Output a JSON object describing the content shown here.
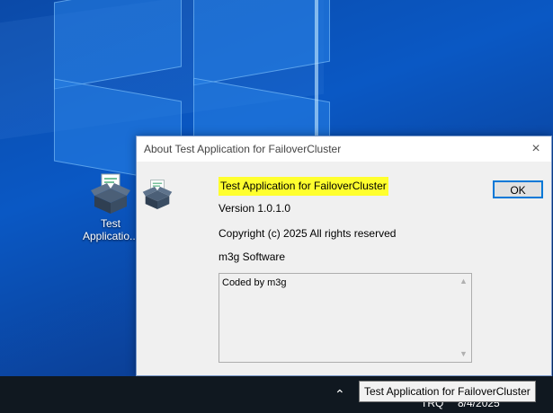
{
  "desktop": {
    "icon_label_line1": "Test",
    "icon_label_line2": "Applicatio..."
  },
  "dialog": {
    "title": "About Test Application for FailoverCluster",
    "close_glyph": "×",
    "product_name": "Test Application for FailoverCluster",
    "version": "Version 1.0.1.0",
    "copyright": "Copyright (c) 2025 All rights reserved",
    "company": "m3g Software",
    "description": "Coded by m3g",
    "ok_label": "OK",
    "highlight_color": "#ffff2e"
  },
  "taskbar": {
    "chevron_glyph": "⌃",
    "language": "TRQ",
    "date": "8/4/2025"
  },
  "tooltip": {
    "text": "Test Application for FailoverCluster"
  },
  "icons": [
    "package-icon",
    "close-icon",
    "chevron-up-icon",
    "scroll-up-icon",
    "scroll-down-icon"
  ]
}
